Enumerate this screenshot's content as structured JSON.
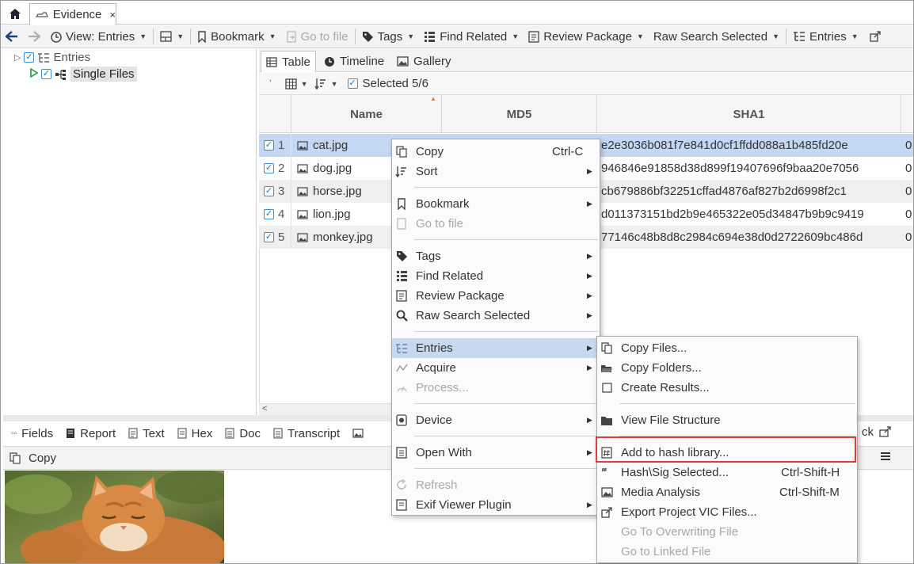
{
  "window": {
    "tab_title": "Evidence",
    "tab_close": "×"
  },
  "toolbar": {
    "view_label": "View: Entries",
    "bookmark_label": "Bookmark",
    "goto_file_label": "Go to file",
    "tags_label": "Tags",
    "find_related_label": "Find Related",
    "review_package_label": "Review Package",
    "raw_search_label": "Raw Search Selected",
    "entries_label": "Entries"
  },
  "tree": {
    "root_label": "Entries",
    "child_label": "Single Files"
  },
  "view_tabs": {
    "table": "Table",
    "timeline": "Timeline",
    "gallery": "Gallery",
    "selected_label": "Selected 5/6"
  },
  "table": {
    "columns": [
      "Name",
      "MD5",
      "SHA1"
    ],
    "rows": [
      {
        "num": "1",
        "name": "cat.jpg",
        "sha1": "e2e3036b081f7e841d0cf1ffdd088a1b485fd20e",
        "extra": "0"
      },
      {
        "num": "2",
        "name": "dog.jpg",
        "sha1": "946846e91858d38d899f19407696f9baa20e7056",
        "extra": "0"
      },
      {
        "num": "3",
        "name": "horse.jpg",
        "sha1": "cb679886bf32251cffad4876af827b2d6998f2c1",
        "extra": "0"
      },
      {
        "num": "4",
        "name": "lion.jpg",
        "sha1": "d011373151bd2b9e465322e05d34847b9b9c9419",
        "extra": "0"
      },
      {
        "num": "5",
        "name": "monkey.jpg",
        "sha1": "77146c48b8d8c2984c694e38d0d2722609bc486d",
        "extra": "0"
      }
    ]
  },
  "bottom_tabs": {
    "fields": "Fields",
    "report": "Report",
    "text": "Text",
    "hex": "Hex",
    "doc": "Doc",
    "transcript": "Transcript",
    "partial_right": "ck"
  },
  "copy_bar": {
    "copy_label": "Copy"
  },
  "context_menu": {
    "copy": "Copy",
    "copy_shortcut": "Ctrl-C",
    "sort": "Sort",
    "bookmark": "Bookmark",
    "goto_file": "Go to file",
    "tags": "Tags",
    "find_related": "Find Related",
    "review_package": "Review Package",
    "raw_search_selected": "Raw Search Selected",
    "entries": "Entries",
    "acquire": "Acquire",
    "process": "Process...",
    "device": "Device",
    "open_with": "Open With",
    "refresh": "Refresh",
    "exif_viewer": "Exif Viewer Plugin"
  },
  "submenu": {
    "copy_files": "Copy Files...",
    "copy_folders": "Copy Folders...",
    "create_results": "Create Results...",
    "view_file_structure": "View File Structure",
    "add_to_hash_library": "Add to hash library...",
    "hash_sig_selected": "Hash\\Sig Selected...",
    "hash_sig_shortcut": "Ctrl-Shift-H",
    "media_analysis": "Media Analysis",
    "media_analysis_shortcut": "Ctrl-Shift-M",
    "export_project_vic": "Export Project VIC Files...",
    "go_to_overwriting": "Go To Overwriting File",
    "go_to_linked": "Go to Linked File"
  }
}
